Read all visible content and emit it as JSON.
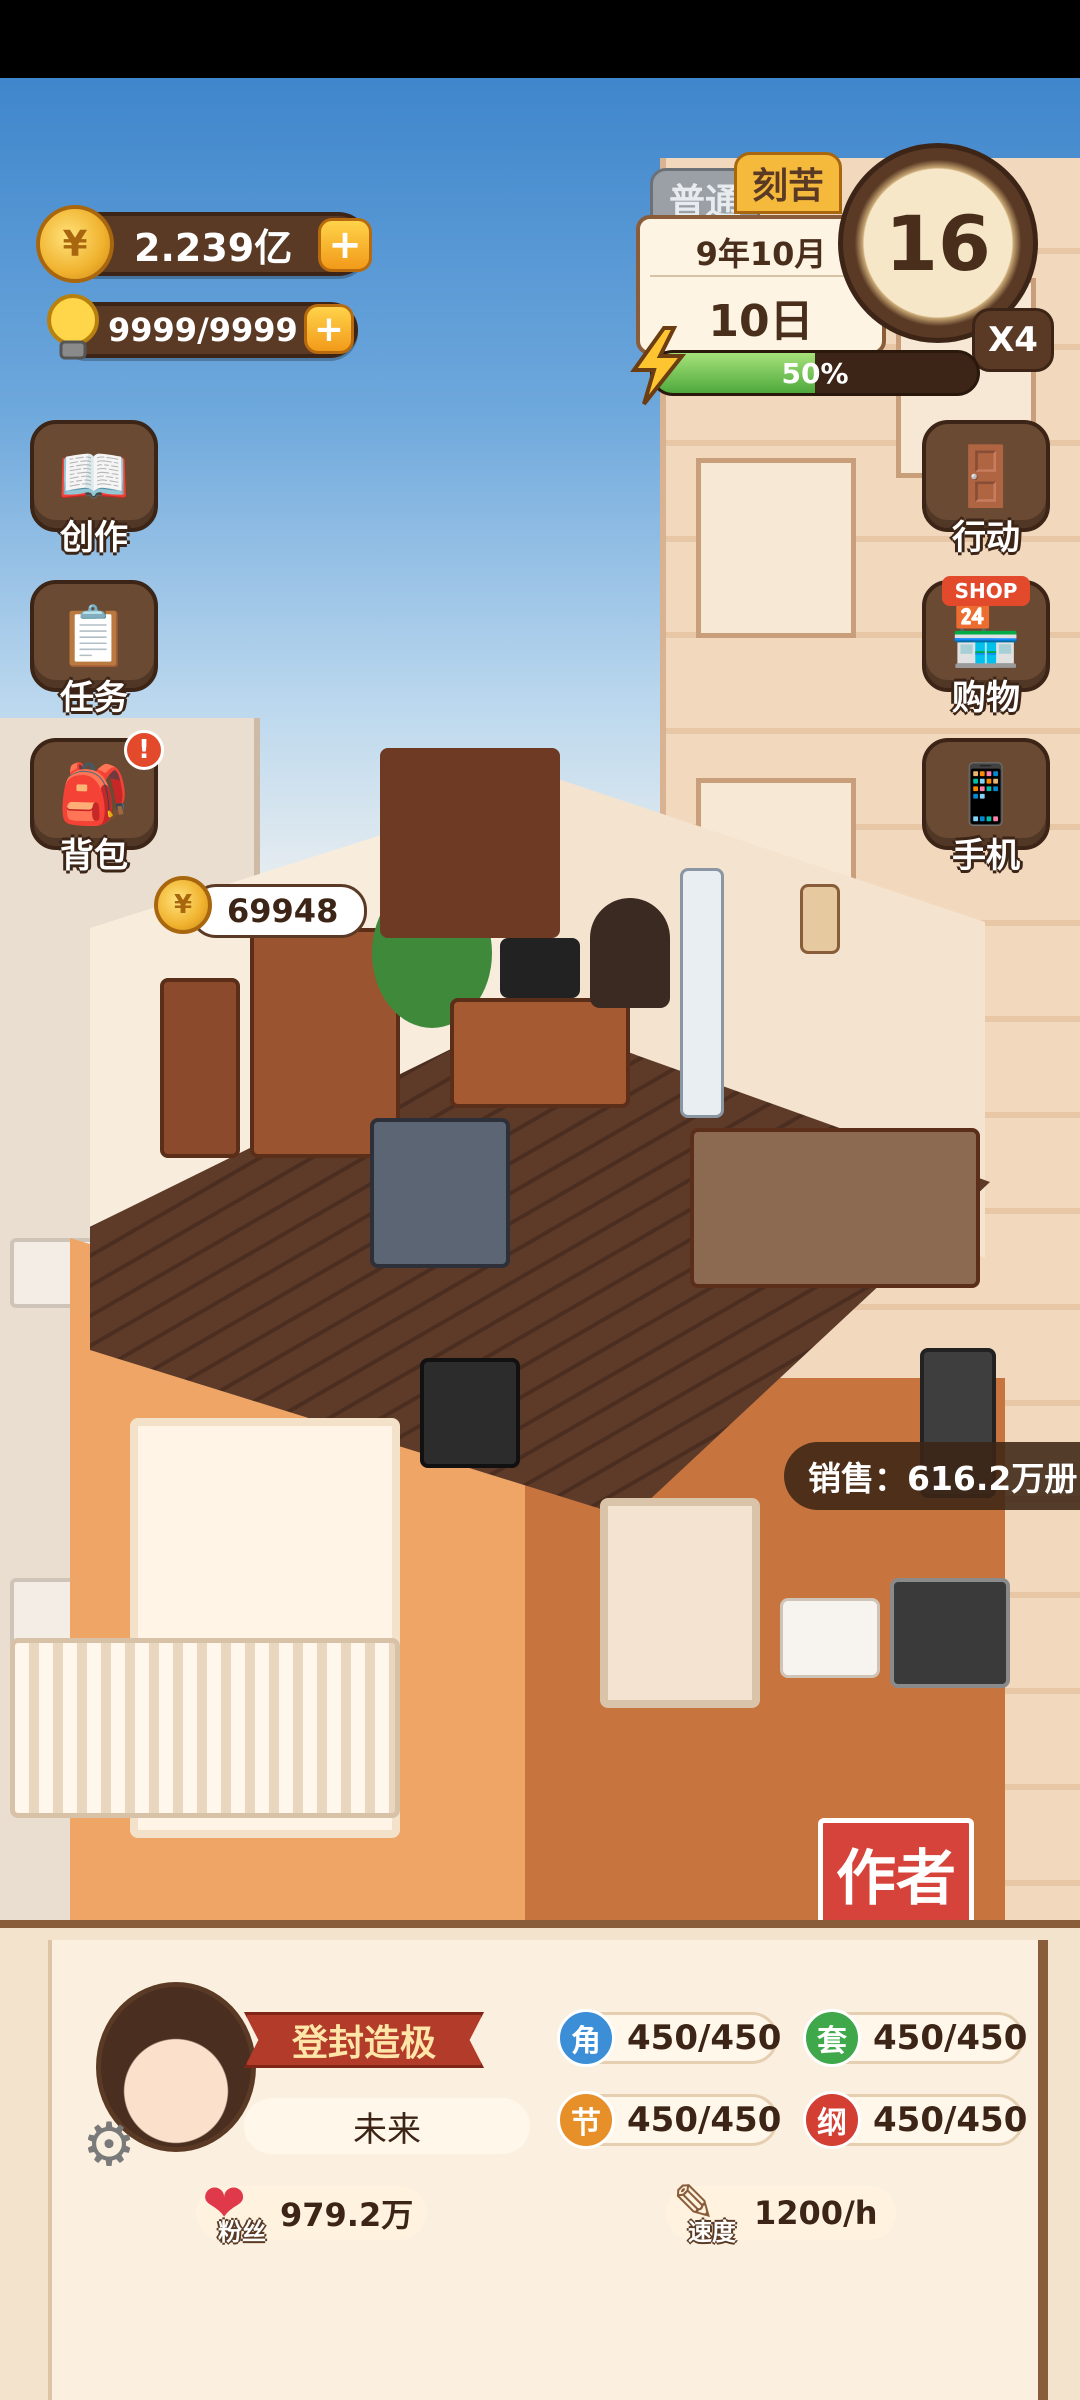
{
  "currency": {
    "coins_value": "2.239亿",
    "coin_symbol": "¥",
    "energy_value": "9999/9999",
    "plus": "+"
  },
  "time_panel": {
    "tab_normal": "普通",
    "tab_hard": "刻苦",
    "year_month": "9年10月",
    "day": "10日",
    "clock_value": "16",
    "speed": "X4",
    "energy_progress_text": "50%",
    "energy_progress": 0.5
  },
  "left_menu": [
    {
      "label": "创作",
      "icon": "book-icon"
    },
    {
      "label": "任务",
      "icon": "clipboard-icon"
    },
    {
      "label": "背包",
      "icon": "backpack-icon",
      "badge": "!"
    }
  ],
  "right_menu": [
    {
      "label": "行动",
      "icon": "door-icon"
    },
    {
      "label": "购物",
      "icon": "shop-icon",
      "sign": "SHOP"
    },
    {
      "label": "手机",
      "icon": "phone-icon"
    }
  ],
  "room": {
    "coin_bubble": "69948"
  },
  "sales": {
    "text": "销售：616.2万册"
  },
  "author_sign": "作者",
  "profile": {
    "title": "登封造极",
    "name": "未来",
    "fans_label": "粉丝",
    "fans_value": "979.2万",
    "speed_label": "速度",
    "speed_value": "1200/h",
    "stats": [
      {
        "icon_char": "角",
        "value": "450/450",
        "color": "#3c8fd6"
      },
      {
        "icon_char": "套",
        "value": "450/450",
        "color": "#3fa84a"
      },
      {
        "icon_char": "节",
        "value": "450/450",
        "color": "#e7902a"
      },
      {
        "icon_char": "纲",
        "value": "450/450",
        "color": "#d43f33"
      }
    ]
  }
}
